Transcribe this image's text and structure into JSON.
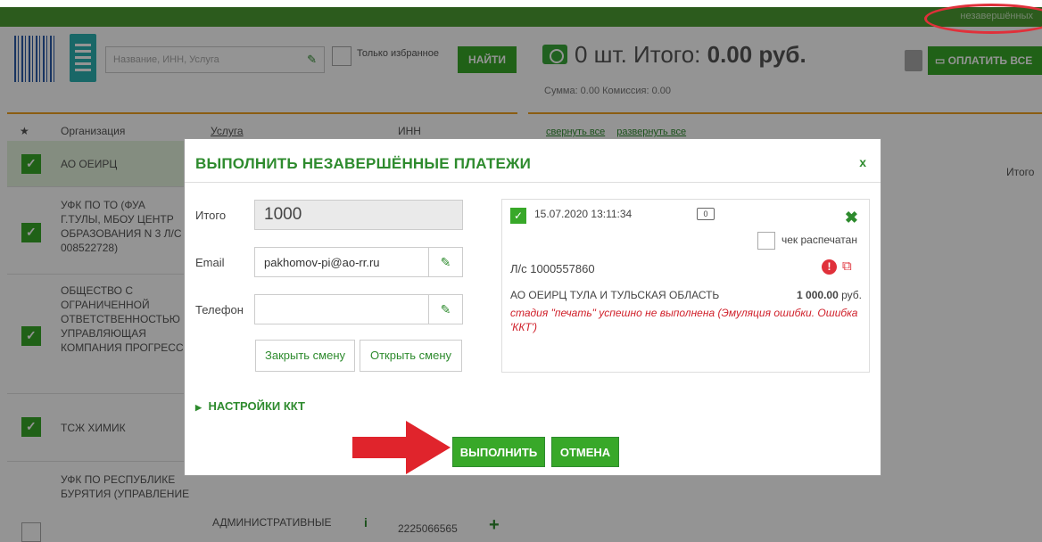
{
  "topbar": {
    "link_label": "незавершённых"
  },
  "search": {
    "placeholder": "Название, ИНН, Услуга",
    "favorites_label": "Только избранное",
    "find_button": "НАЙТИ"
  },
  "summary": {
    "count_text": "0 шт. Итого:",
    "total_text": "0.00 руб.",
    "sub_text": "Сумма: 0.00 Комиссия: 0.00",
    "pay_all_button": "ОПЛАТИТЬ ВСЕ",
    "collapse_all": "свернуть все",
    "expand_all": "развернуть все",
    "total_column": "Итого"
  },
  "table": {
    "columns": [
      "Организация",
      "Услуга",
      "ИНН"
    ],
    "rows": [
      {
        "org": "АО ОЕИРЦ",
        "checked": true
      },
      {
        "org": "УФК ПО ТО (ФУА Г.ТУЛЫ, МБОУ ЦЕНТР ОБРАЗОВАНИЯ N 3 Л/С 008522728)",
        "checked": true
      },
      {
        "org": "ОБЩЕСТВО С ОГРАНИЧЕННОЙ ОТВЕТСТВЕННОСТЬЮ УПРАВЛЯЮЩАЯ КОМПАНИЯ ПРОГРЕСС",
        "checked": true
      },
      {
        "org": "ТСЖ ХИМИК",
        "checked": true
      },
      {
        "org": "УФК ПО РЕСПУБЛИКЕ БУРЯТИЯ (УПРАВЛЕНИЕ",
        "service": "АДМИНИСТРАТИВНЫЕ",
        "inn": "2225066565",
        "checked": false
      }
    ]
  },
  "modal": {
    "title": "ВЫПОЛНИТЬ НЕЗАВЕРШЁННЫЕ ПЛАТЕЖИ",
    "close": "x",
    "total_label": "Итого",
    "total_value": "1000",
    "email_label": "Email",
    "email_value": "pakhomov-pi@ao-rr.ru",
    "phone_label": "Телефон",
    "phone_value": "",
    "close_shift_button": "Закрыть смену",
    "open_shift_button": "Открыть смену",
    "kkt_settings": "НАСТРОЙКИ ККТ",
    "execute_button": "ВЫПОЛНИТЬ",
    "cancel_button": "ОТМЕНА",
    "payment": {
      "datetime": "15.07.2020 13:11:34",
      "printed_label": "чек распечатан",
      "account": "Л/с 1000557860",
      "organization": "АО ОЕИРЦ ТУЛА И ТУЛЬСКАЯ ОБЛАСТЬ",
      "amount": "1 000.00",
      "currency": "руб.",
      "error": "стадия \"печать\" успешно не выполнена (Эмуляция ошибки. Ошибка 'ККТ')"
    }
  },
  "colors": {
    "brand_green": "#38a829",
    "error_red": "#d0202a",
    "warning_orange": "#f0a020"
  }
}
